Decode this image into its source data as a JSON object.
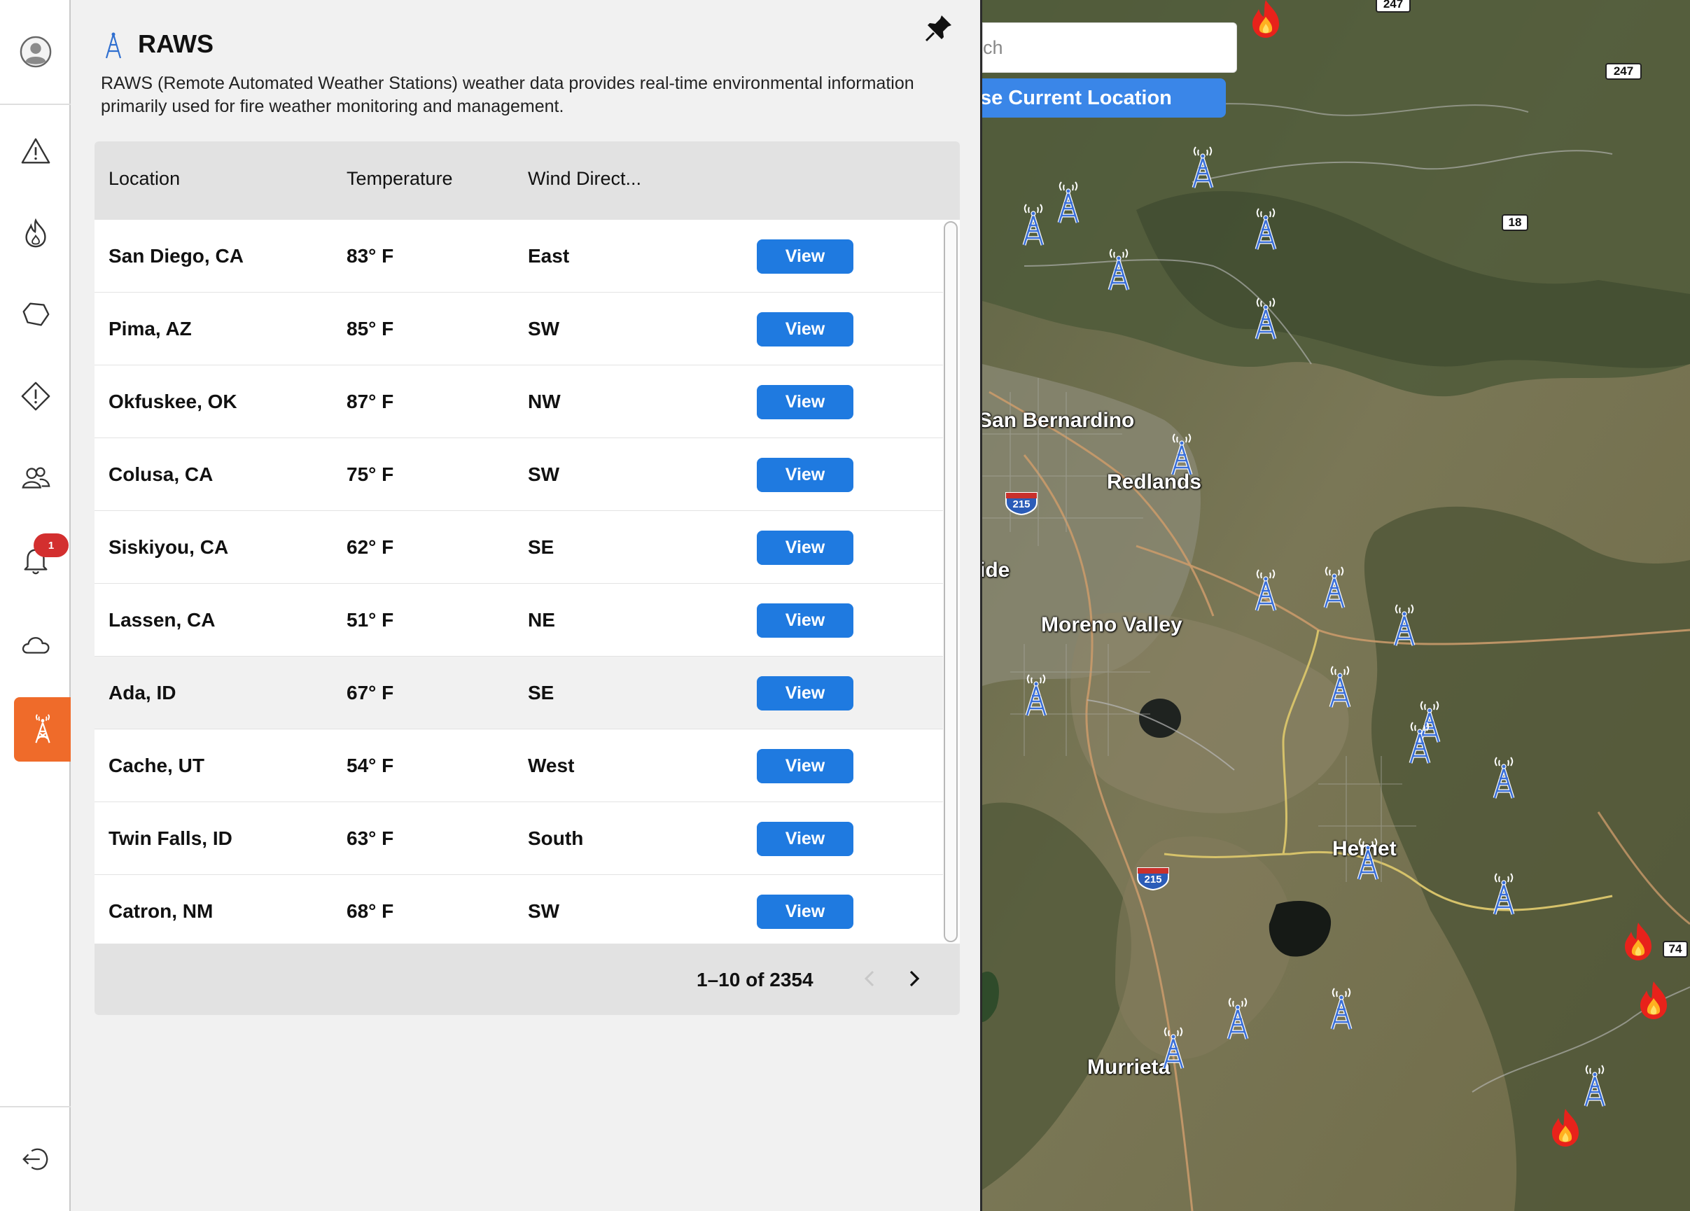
{
  "panel": {
    "title": "RAWS",
    "description": "RAWS (Remote Automated Weather Stations) weather data provides real-time environmental information primarily used for fire weather monitoring and management."
  },
  "table": {
    "columns": [
      "Location",
      "Temperature",
      "Wind Direct..."
    ],
    "rows": [
      {
        "location": "San Diego, CA",
        "temperature": "83° F",
        "wind": "East",
        "action": "View"
      },
      {
        "location": "Pima, AZ",
        "temperature": "85° F",
        "wind": "SW",
        "action": "View"
      },
      {
        "location": "Okfuskee, OK",
        "temperature": "87° F",
        "wind": "NW",
        "action": "View"
      },
      {
        "location": "Colusa, CA",
        "temperature": "75° F",
        "wind": "SW",
        "action": "View"
      },
      {
        "location": "Siskiyou, CA",
        "temperature": "62° F",
        "wind": "SE",
        "action": "View"
      },
      {
        "location": "Lassen, CA",
        "temperature": "51° F",
        "wind": "NE",
        "action": "View"
      },
      {
        "location": "Ada, ID",
        "temperature": "67° F",
        "wind": "SE",
        "action": "View"
      },
      {
        "location": "Cache, UT",
        "temperature": "54° F",
        "wind": "West",
        "action": "View"
      },
      {
        "location": "Twin Falls, ID",
        "temperature": "63° F",
        "wind": "South",
        "action": "View"
      },
      {
        "location": "Catron, NM",
        "temperature": "68° F",
        "wind": "SW",
        "action": "View"
      }
    ],
    "highlighted_row": 6,
    "pagination": "1–10 of 2354"
  },
  "nav": {
    "notification_count": "1",
    "icons": [
      "user-avatar-icon",
      "alert-triangle-icon",
      "fire-icon",
      "polygon-icon",
      "warning-diamond-icon",
      "people-icon",
      "bell-icon",
      "cloud-icon",
      "raws-tower-icon",
      "logout-icon"
    ],
    "active": "raws-tower-icon",
    "active_color": "#ef6b2a"
  },
  "map": {
    "search_placeholder": "ch",
    "location_button": "Use Current Location",
    "cities": [
      {
        "name": "San Bernardino"
      },
      {
        "name": "Redlands"
      },
      {
        "name": "ide"
      },
      {
        "name": "Moreno Valley"
      },
      {
        "name": "Hemet"
      },
      {
        "name": "Murrieta"
      }
    ],
    "route_shields": [
      "247",
      "247",
      "18",
      "74"
    ],
    "interstate_shields": [
      "215",
      "215"
    ]
  },
  "colors": {
    "accent": "#1f7ae0",
    "nav_active": "#ef6b2a",
    "badge": "#d32f2f"
  }
}
